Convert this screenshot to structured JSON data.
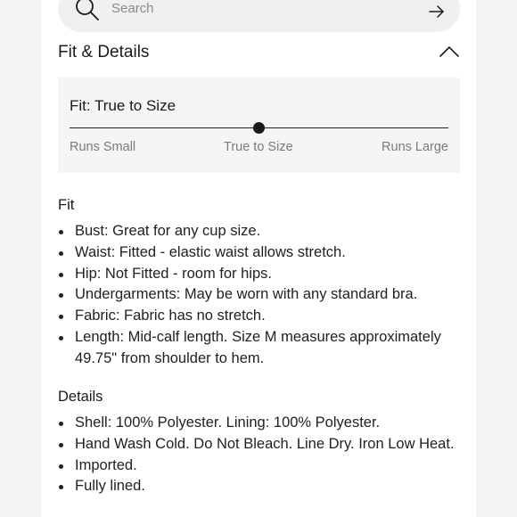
{
  "search": {
    "placeholder": "Search",
    "icon": "search-icon",
    "submit_icon": "arrow-right-icon"
  },
  "section": {
    "title": "Fit & Details",
    "toggle_icon": "chevron-up-icon",
    "expanded": true
  },
  "fit_scale": {
    "title": "Fit: True to Size",
    "labels": [
      "Runs Small",
      "True to Size",
      "Runs Large"
    ],
    "position": 0.5
  },
  "fit": {
    "heading": "Fit",
    "items": [
      "Bust: Great for any cup size.",
      "Waist: Fitted - elastic waist allows stretch.",
      "Hip: Not Fitted - room for hips.",
      "Undergarments: May be worn with any standard bra.",
      "Fabric: Fabric has no stretch.",
      "Length: Mid-calf length. Size M measures approximately 49.75\" from shoulder to hem."
    ]
  },
  "details": {
    "heading": "Details",
    "items": [
      "Shell: 100% Polyester. Lining: 100% Polyester.",
      "Hand Wash Cold. Do Not Bleach. Line Dry. Iron Low Heat.",
      "Imported.",
      "Fully lined."
    ]
  },
  "colors": {
    "background": "#f4f4f4",
    "panel": "#ffffff",
    "search_bg": "#f0f0f0",
    "fit_box_bg": "#f5f5f5",
    "text": "#1a1a1a",
    "muted": "#7a7a7a"
  }
}
